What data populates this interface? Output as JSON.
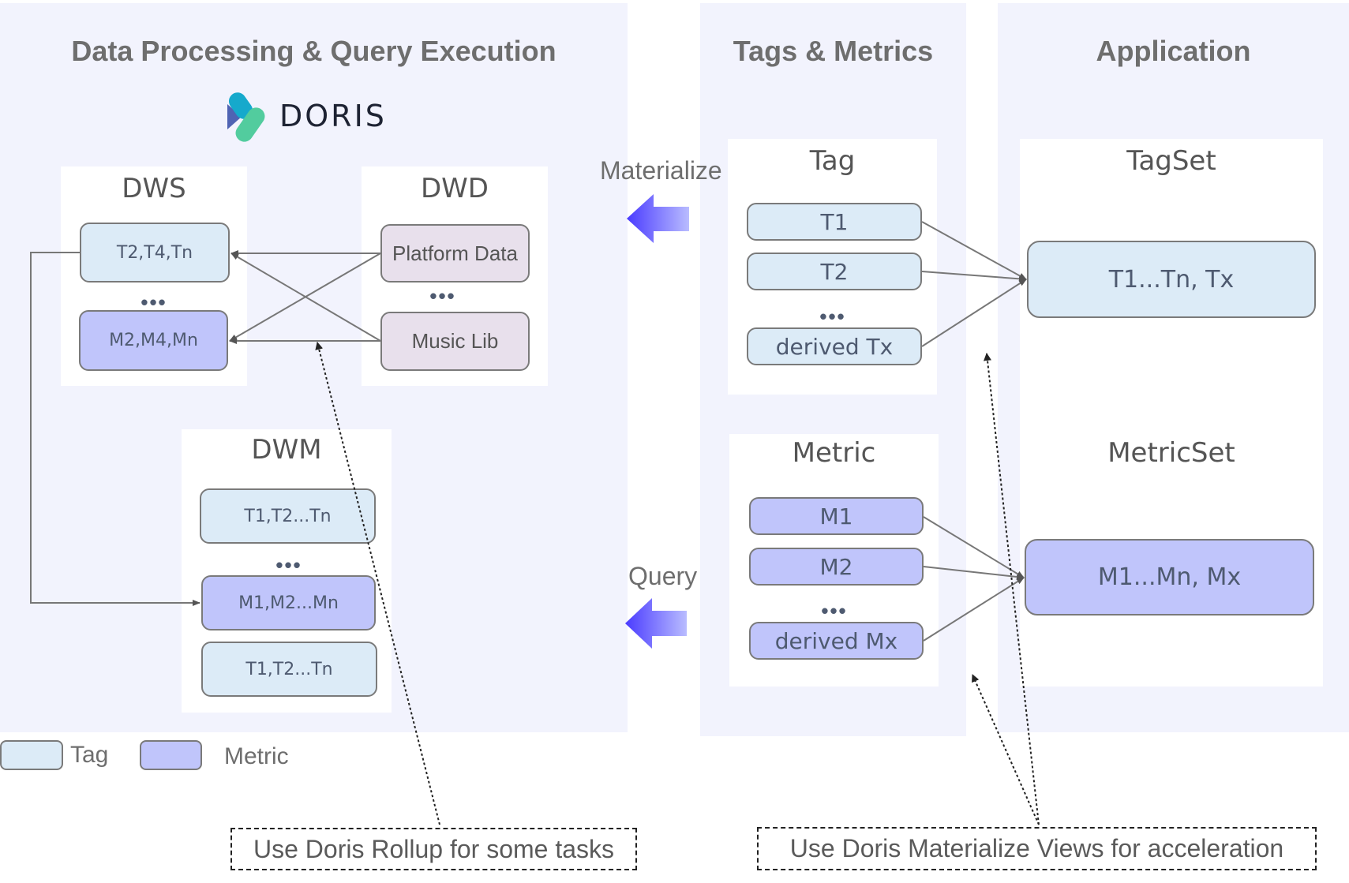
{
  "columns": {
    "processing": {
      "title": "Data Processing & Query Execution"
    },
    "tags_metrics": {
      "title": "Tags & Metrics"
    },
    "application": {
      "title": "Application"
    }
  },
  "logo": {
    "text": "DORIS",
    "icon": "doris-logo-icon"
  },
  "dws": {
    "title": "DWS",
    "tag_node": "T2,T4,Tn",
    "metric_node": "M2,M4,Mn",
    "ellipsis": "•••"
  },
  "dwd": {
    "title": "DWD",
    "source_1": "Platform Data",
    "source_2": "Music Lib",
    "ellipsis": "•••"
  },
  "dwm": {
    "title": "DWM",
    "tag_node_1": "T1,T2...Tn",
    "metric_node": "M1,M2...Mn",
    "tag_node_2": "T1,T2...Tn",
    "ellipsis": "•••"
  },
  "tag_panel": {
    "title": "Tag",
    "items": [
      "T1",
      "T2",
      "derived Tx"
    ],
    "ellipsis": "•••"
  },
  "metric_panel": {
    "title": "Metric",
    "items": [
      "M1",
      "M2",
      "derived Mx"
    ],
    "ellipsis": "•••"
  },
  "tagset": {
    "title": "TagSet",
    "node": "T1...Tn, Tx"
  },
  "metricset": {
    "title": "MetricSet",
    "node": "M1...Mn, Mx"
  },
  "flows": {
    "materialize": "Materialize",
    "query": "Query"
  },
  "legend": {
    "tag": "Tag",
    "metric": "Metric"
  },
  "notes": {
    "rollup": "Use Doris Rollup for some tasks",
    "mv": "Use Doris Materialize Views for acceleration"
  },
  "colors": {
    "tag": "#dcebf7",
    "metric": "#c0c5fb",
    "source": "#e8e0ec",
    "column_bg": "#f2f3fd",
    "arrow": "#5544ff"
  }
}
